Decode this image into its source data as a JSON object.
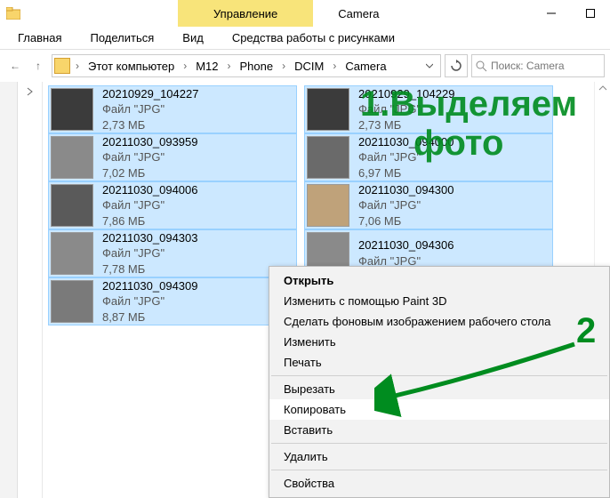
{
  "titlebar": {
    "contextual_tab": "Управление",
    "title": "Camera"
  },
  "menubar": {
    "tabs": [
      "Главная",
      "Поделиться",
      "Вид",
      "Средства работы с рисунками"
    ]
  },
  "breadcrumb": {
    "parts": [
      "Этот компьютер",
      "M12",
      "Phone",
      "DCIM",
      "Camera"
    ]
  },
  "search": {
    "placeholder": "Поиск: Camera"
  },
  "files": [
    [
      {
        "name": "20210929_104227",
        "type": "Файл \"JPG\"",
        "size": "2,73 МБ",
        "sel": true,
        "thumb": "#3b3b3b"
      },
      {
        "name": "20210929_104229",
        "type": "Файл \"JPG\"",
        "size": "2,73 МБ",
        "sel": true,
        "thumb": "#3b3b3b"
      }
    ],
    [
      {
        "name": "20211030_093959",
        "type": "Файл \"JPG\"",
        "size": "7,02 МБ",
        "sel": true,
        "thumb": "#8a8a8a"
      },
      {
        "name": "20211030_094000",
        "type": "Файл \"JPG\"",
        "size": "6,97 МБ",
        "sel": true,
        "thumb": "#6a6a6a"
      }
    ],
    [
      {
        "name": "20211030_094006",
        "type": "Файл \"JPG\"",
        "size": "7,86 МБ",
        "sel": true,
        "thumb": "#5a5a5a"
      },
      {
        "name": "20211030_094300",
        "type": "Файл \"JPG\"",
        "size": "7,06 МБ",
        "sel": true,
        "thumb": "#bfa27a"
      }
    ],
    [
      {
        "name": "20211030_094303",
        "type": "Файл \"JPG\"",
        "size": "7,78 МБ",
        "sel": true,
        "thumb": "#8a8a8a"
      },
      {
        "name": "20211030_094306",
        "type": "Файл \"JPG\"",
        "size": "",
        "sel": true,
        "thumb": "#8a8a8a"
      }
    ],
    [
      {
        "name": "20211030_094309",
        "type": "Файл \"JPG\"",
        "size": "8,87 МБ",
        "sel": true,
        "thumb": "#7a7a7a"
      },
      null
    ]
  ],
  "context_menu": {
    "items": [
      {
        "label": "Открыть",
        "bold": true
      },
      {
        "label": "Изменить с помощью Paint 3D"
      },
      {
        "label": "Сделать фоновым изображением рабочего стола"
      },
      {
        "label": "Изменить"
      },
      {
        "label": "Печать"
      },
      {
        "sep": true
      },
      {
        "label": "Вырезать"
      },
      {
        "label": "Копировать",
        "hover": true
      },
      {
        "label": "Вставить"
      },
      {
        "sep": true
      },
      {
        "label": "Удалить"
      },
      {
        "sep": true
      },
      {
        "label": "Свойства"
      }
    ]
  },
  "annotations": {
    "step1_a": "1.Выделяем",
    "step1_b": "фото",
    "step2": "2"
  }
}
